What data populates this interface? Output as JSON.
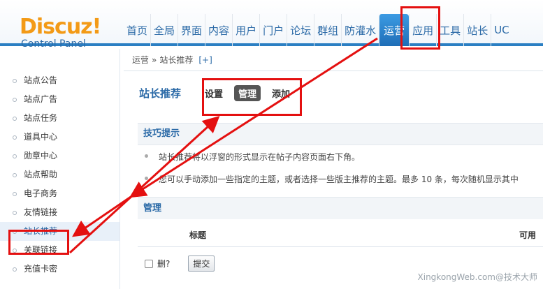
{
  "logo": {
    "brand": "Discuz!",
    "subtitle": "Control Panel"
  },
  "nav": {
    "items": [
      {
        "label": "首页"
      },
      {
        "label": "全局"
      },
      {
        "label": "界面"
      },
      {
        "label": "内容"
      },
      {
        "label": "用户"
      },
      {
        "label": "门户"
      },
      {
        "label": "论坛"
      },
      {
        "label": "群组"
      },
      {
        "label": "防灌水"
      },
      {
        "label": "运营",
        "active": true
      },
      {
        "label": "应用"
      },
      {
        "label": "工具"
      },
      {
        "label": "站长"
      },
      {
        "label": "UC"
      }
    ]
  },
  "breadcrumb": {
    "root": "运营",
    "sep": "»",
    "current": "站长推荐",
    "add": "[+]"
  },
  "sidebar": {
    "items": [
      {
        "label": "站点公告"
      },
      {
        "label": "站点广告"
      },
      {
        "label": "站点任务"
      },
      {
        "label": "道具中心"
      },
      {
        "label": "勋章中心"
      },
      {
        "label": "站点帮助"
      },
      {
        "label": "电子商务"
      },
      {
        "label": "友情链接"
      },
      {
        "label": "站长推荐",
        "active": true
      },
      {
        "label": "关联链接"
      },
      {
        "label": "充值卡密"
      }
    ]
  },
  "page": {
    "title": "站长推荐",
    "tabs": [
      {
        "label": "设置"
      },
      {
        "label": "管理",
        "active": true
      },
      {
        "label": "添加"
      }
    ]
  },
  "tips": {
    "heading": "技巧提示",
    "items": [
      "站长推荐将以浮窗的形式显示在帖子内容页面右下角。",
      "您可以手动添加一些指定的主题，或者选择一些版主推荐的主题。最多 10 条，每次随机显示其中"
    ]
  },
  "manage": {
    "heading": "管理",
    "col_title": "标题",
    "col_available": "可用",
    "delete_label": "删?",
    "submit_label": "提交"
  },
  "watermark": "XingkongWeb.com@技术大师",
  "colors": {
    "accent": "#2b6aa7",
    "brand_orange": "#f39a16",
    "annotation_red": "#e41010"
  }
}
